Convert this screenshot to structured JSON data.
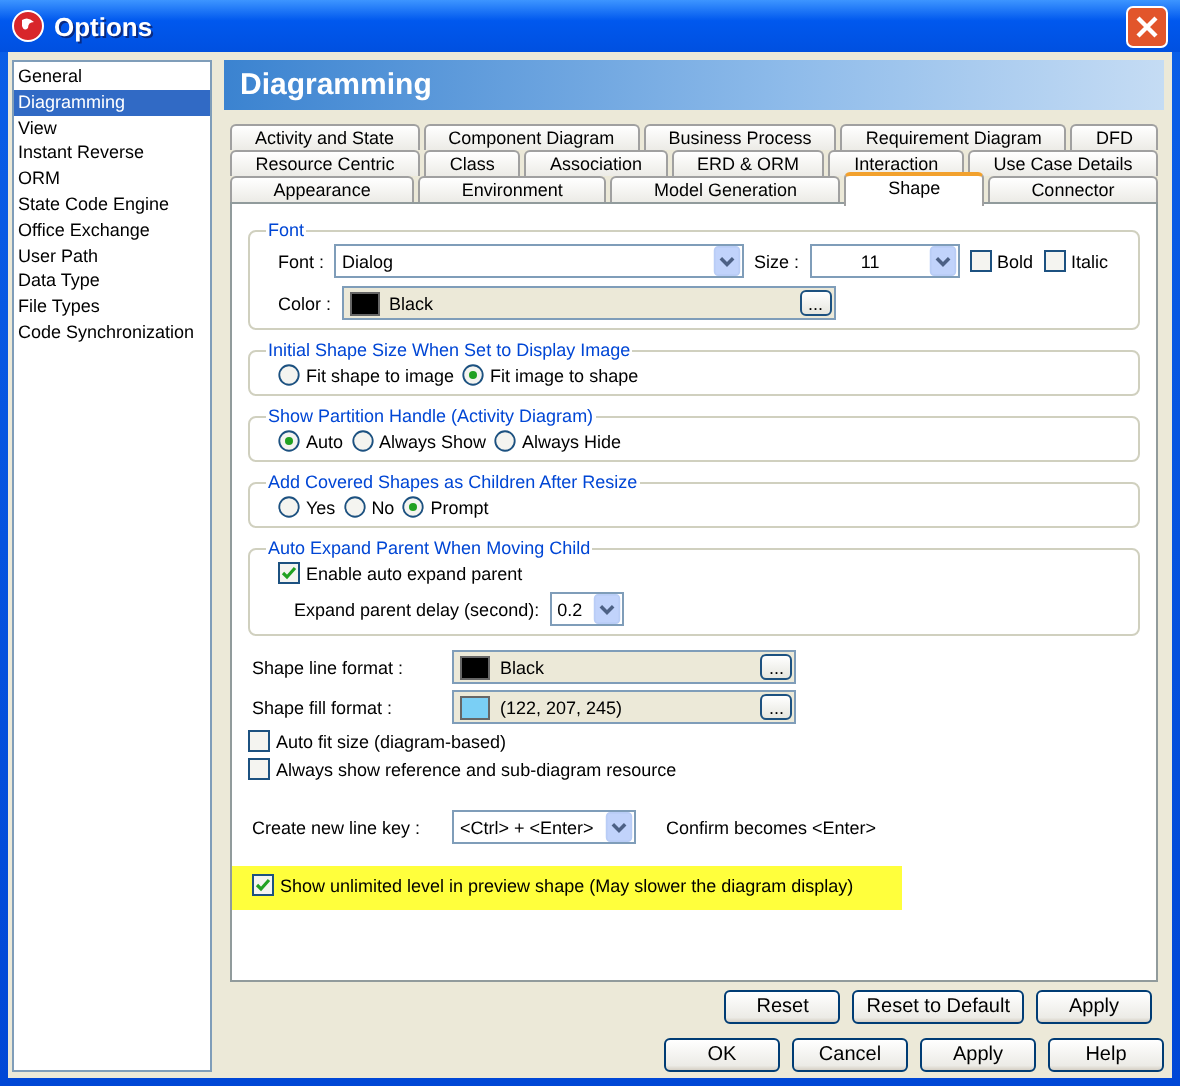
{
  "window": {
    "title": "Options"
  },
  "sidebar": {
    "items": [
      {
        "label": "General",
        "selected": false
      },
      {
        "label": "Diagramming",
        "selected": true
      },
      {
        "label": "View",
        "selected": false
      },
      {
        "label": "Instant Reverse",
        "selected": false
      },
      {
        "label": "ORM",
        "selected": false
      },
      {
        "label": "State Code Engine",
        "selected": false
      },
      {
        "label": "Office Exchange",
        "selected": false
      },
      {
        "label": "User Path",
        "selected": false
      },
      {
        "label": "Data Type",
        "selected": false
      },
      {
        "label": "File Types",
        "selected": false
      },
      {
        "label": "Code Synchronization",
        "selected": false
      }
    ]
  },
  "header": {
    "title": "Diagramming"
  },
  "tab_rows": [
    [
      {
        "label": "Activity and State",
        "selected": false
      },
      {
        "label": "Component Diagram",
        "selected": false
      },
      {
        "label": "Business Process",
        "selected": false
      },
      {
        "label": "Requirement Diagram",
        "selected": false
      },
      {
        "label": "DFD",
        "selected": false
      }
    ],
    [
      {
        "label": "Resource Centric",
        "selected": false
      },
      {
        "label": "Class",
        "selected": false
      },
      {
        "label": "Association",
        "selected": false
      },
      {
        "label": "ERD & ORM",
        "selected": false
      },
      {
        "label": "Interaction",
        "selected": false
      },
      {
        "label": "Use Case Details",
        "selected": false
      }
    ],
    [
      {
        "label": "Appearance",
        "selected": false
      },
      {
        "label": "Environment",
        "selected": false
      },
      {
        "label": "Model Generation",
        "selected": false
      },
      {
        "label": "Shape",
        "selected": true
      },
      {
        "label": "Connector",
        "selected": false
      }
    ]
  ],
  "font_group": {
    "title": "Font",
    "font_label": "Font :",
    "font_value": "Dialog",
    "size_label": "Size :",
    "size_value": "11",
    "bold": {
      "label": "Bold",
      "checked": false
    },
    "italic": {
      "label": "Italic",
      "checked": false
    },
    "color_label": "Color :",
    "color": "#000000",
    "color_value": "Black",
    "browse": "..."
  },
  "groups": [
    {
      "kind": "radio",
      "title": "Initial Shape Size When Set to Display Image",
      "options": [
        {
          "label": "Fit shape to image",
          "selected": false
        },
        {
          "label": "Fit image to shape",
          "selected": true
        }
      ]
    },
    {
      "kind": "radio",
      "title": "Show Partition Handle (Activity Diagram)",
      "options": [
        {
          "label": "Auto",
          "selected": true
        },
        {
          "label": "Always Show",
          "selected": false
        },
        {
          "label": "Always Hide",
          "selected": false
        }
      ]
    },
    {
      "kind": "radio",
      "title": "Add Covered Shapes as Children After Resize",
      "options": [
        {
          "label": "Yes",
          "selected": false
        },
        {
          "label": "No",
          "selected": false
        },
        {
          "label": "Prompt",
          "selected": true
        }
      ]
    },
    {
      "kind": "expand",
      "title": "Auto Expand Parent When Moving Child",
      "checkbox": {
        "label": "Enable auto expand parent",
        "checked": true
      },
      "delay_label": "Expand parent delay (second):",
      "delay_value": "0.2"
    }
  ],
  "formats": [
    {
      "label": "Shape line format :",
      "color": "#000000",
      "value": "Black",
      "browse": "..."
    },
    {
      "label": "Shape fill format :",
      "color": "#7acff5",
      "value": "(122, 207, 245)",
      "browse": "..."
    }
  ],
  "options": [
    {
      "label": "Auto fit size (diagram-based)",
      "checked": false
    },
    {
      "label": "Always show reference and sub-diagram resource",
      "checked": false
    }
  ],
  "line_key": {
    "label": "Create new line key :",
    "value": "<Ctrl> + <Enter>",
    "note": "Confirm becomes <Enter>"
  },
  "unlimited": {
    "label": "Show unlimited level in preview shape (May slower the diagram display)",
    "checked": true,
    "highlighted": true
  },
  "panel_buttons": [
    "Reset",
    "Reset to Default",
    "Apply"
  ],
  "dialog_buttons": [
    "OK",
    "Cancel",
    "Apply",
    "Help"
  ]
}
